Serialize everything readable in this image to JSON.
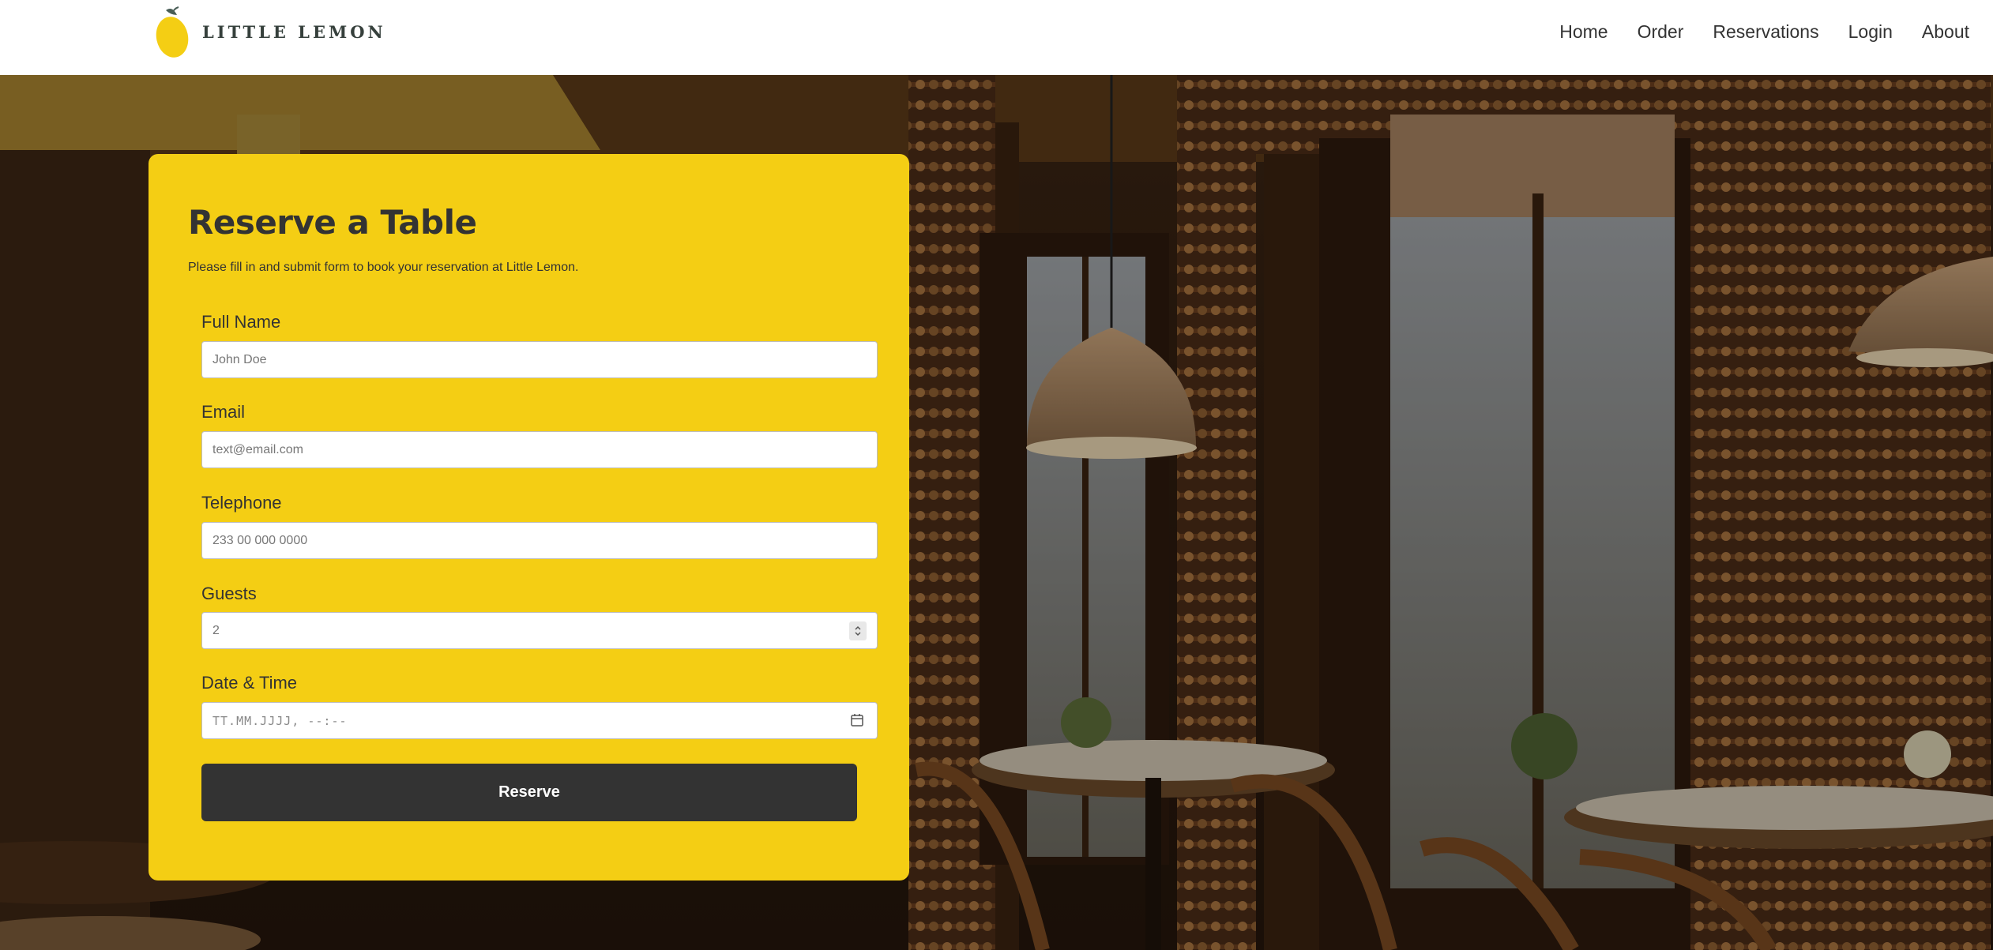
{
  "header": {
    "brand": "LITTLE LEMON",
    "nav": [
      {
        "label": "Home"
      },
      {
        "label": "Order"
      },
      {
        "label": "Reservations"
      },
      {
        "label": "Login"
      },
      {
        "label": "About"
      }
    ]
  },
  "form": {
    "title": "Reserve a Table",
    "subtitle": "Please fill in and submit form to book your reservation at Little Lemon.",
    "fields": {
      "full_name": {
        "label": "Full Name",
        "placeholder": "John Doe"
      },
      "email": {
        "label": "Email",
        "placeholder": "text@email.com"
      },
      "telephone": {
        "label": "Telephone",
        "placeholder": "233 00 000 0000"
      },
      "guests": {
        "label": "Guests",
        "value": "2"
      },
      "datetime": {
        "label": "Date & Time",
        "placeholder": "TT.MM.JJJJ, --:--"
      }
    },
    "submit_label": "Reserve"
  },
  "colors": {
    "brand_yellow": "#f4ce14",
    "button_dark": "#333333",
    "header_bg": "#ffffff"
  },
  "icons": {
    "logo": "lemon-logo-icon",
    "stepper": "number-stepper-icon",
    "calendar": "calendar-icon"
  }
}
